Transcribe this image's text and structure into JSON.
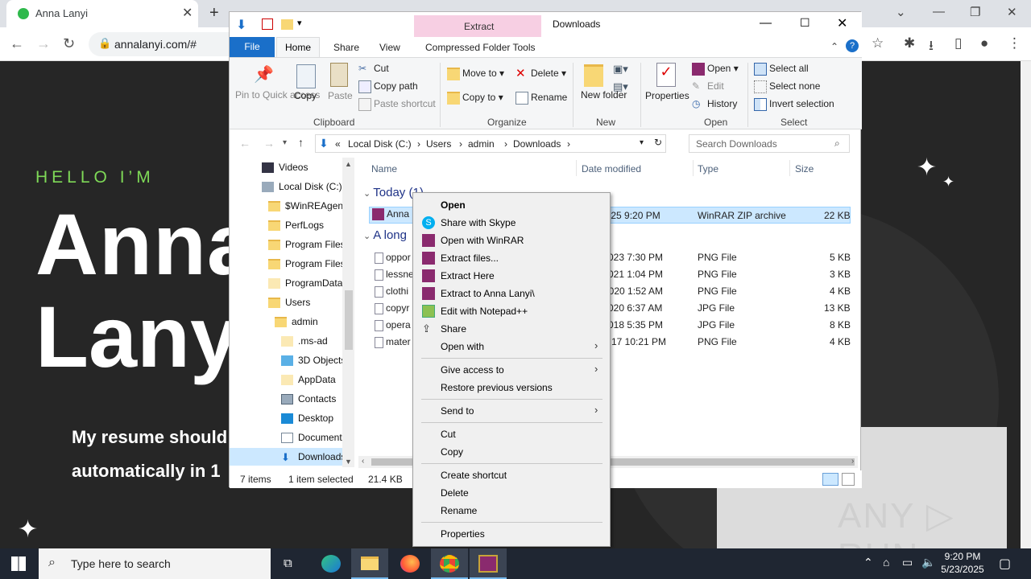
{
  "chrome": {
    "tab_title": "Anna Lanyi",
    "url": "annalanyi.com/#",
    "new_tab": "+",
    "tab_close": "✕"
  },
  "page": {
    "hello": "HELLO I’M",
    "name_line1": "Anna",
    "name_line2": "Lanyi",
    "sub_line1": "My resume should",
    "sub_line2": "automatically in 1",
    "watermark": "ANY ▷ RUN"
  },
  "explorer": {
    "title": "Downloads",
    "ctx_tab": "Extract",
    "tabs": {
      "file": "File",
      "home": "Home",
      "share": "Share",
      "view": "View",
      "tools": "Compressed Folder Tools"
    },
    "ribbon": {
      "pin": "Pin to Quick access",
      "copy": "Copy",
      "paste": "Paste",
      "cut": "Cut",
      "copy_path": "Copy path",
      "paste_shortcut": "Paste shortcut",
      "g_clipboard": "Clipboard",
      "move_to": "Move to",
      "copy_to": "Copy to",
      "delete": "Delete",
      "rename": "Rename",
      "g_organize": "Organize",
      "new_folder": "New folder",
      "g_new": "New",
      "properties": "Properties",
      "open": "Open",
      "edit": "Edit",
      "history": "History",
      "g_open": "Open",
      "select_all": "Select all",
      "select_none": "Select none",
      "invert": "Invert selection",
      "g_select": "Select"
    },
    "address": {
      "sep": "«",
      "parts": [
        "Local Disk (C:)",
        "Users",
        "admin",
        "Downloads"
      ]
    },
    "search_placeholder": "Search Downloads",
    "nav": [
      "Videos",
      "Local Disk (C:)",
      "$WinREAgent",
      "PerfLogs",
      "Program Files",
      "Program Files",
      "ProgramData",
      "Users",
      "admin",
      ".ms-ad",
      "3D Objects",
      "AppData",
      "Contacts",
      "Desktop",
      "Documents",
      "Downloads"
    ],
    "columns": {
      "name": "Name",
      "date": "Date modified",
      "type": "Type",
      "size": "Size"
    },
    "group_today": "Today (1)",
    "group_old": "A long",
    "selected_file": {
      "name": "Anna",
      "date": "2025 9:20 PM",
      "type": "WinRAR ZIP archive",
      "size": "22 KB"
    },
    "files": [
      {
        "name": "oppor",
        "date": "023 7:30 PM",
        "type": "PNG File",
        "size": "5 KB"
      },
      {
        "name": "lessne",
        "date": "021 1:04 PM",
        "type": "PNG File",
        "size": "3 KB"
      },
      {
        "name": "clothi",
        "date": "2020 1:52 AM",
        "type": "PNG File",
        "size": "4 KB"
      },
      {
        "name": "copyr",
        "date": "020 6:37 AM",
        "type": "JPG File",
        "size": "13 KB"
      },
      {
        "name": "opera",
        "date": "018 5:35 PM",
        "type": "JPG File",
        "size": "8 KB"
      },
      {
        "name": "mater",
        "date": "17 10:21 PM",
        "type": "PNG File",
        "size": "4 KB"
      }
    ],
    "status": {
      "items": "7 items",
      "selected": "1 item selected",
      "size": "21.4 KB"
    }
  },
  "context_menu": [
    {
      "label": "Open",
      "bold": true
    },
    {
      "label": "Share with Skype"
    },
    {
      "label": "Open with WinRAR"
    },
    {
      "label": "Extract files..."
    },
    {
      "label": "Extract Here"
    },
    {
      "label": "Extract to Anna Lanyi\\"
    },
    {
      "label": "Edit with Notepad++"
    },
    {
      "label": "Share"
    },
    {
      "label": "Open with"
    },
    {
      "label": "Give access to"
    },
    {
      "label": "Restore previous versions"
    },
    {
      "label": "Send to"
    },
    {
      "label": "Cut"
    },
    {
      "label": "Copy"
    },
    {
      "label": "Create shortcut"
    },
    {
      "label": "Delete"
    },
    {
      "label": "Rename"
    },
    {
      "label": "Properties"
    }
  ],
  "taskbar": {
    "search_placeholder": "Type here to search",
    "time": "9:20 PM",
    "date": "5/23/2025"
  }
}
